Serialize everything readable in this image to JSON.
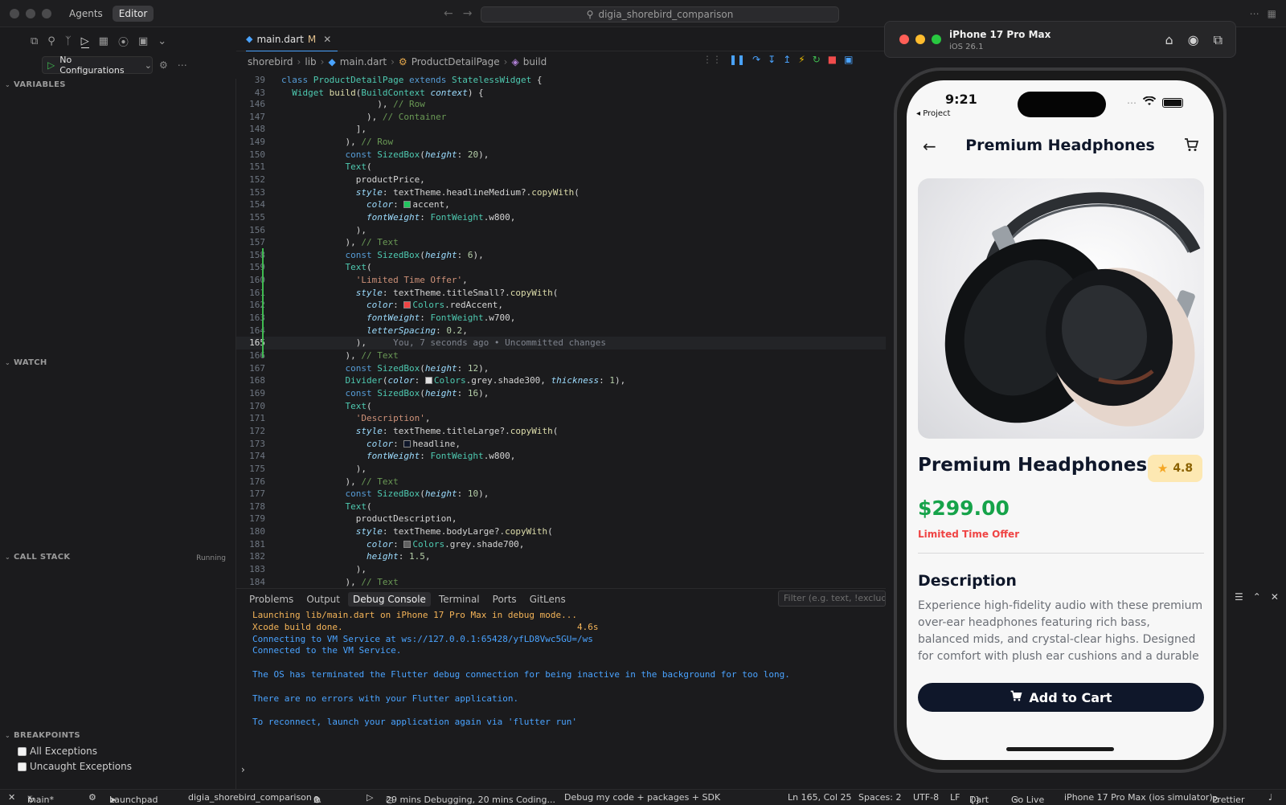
{
  "titlebar": {
    "tabs": [
      "Agents",
      "Editor"
    ],
    "search": "digia_shorebird_comparison"
  },
  "run": {
    "config_label": "No Configurations"
  },
  "sidebar": {
    "variables": "VARIABLES",
    "watch": "WATCH",
    "call_stack": "CALL STACK",
    "call_stack_status": "Running",
    "breakpoints": "BREAKPOINTS",
    "bp_items": [
      "All Exceptions",
      "Uncaught Exceptions"
    ]
  },
  "editor": {
    "tab": {
      "name": "main.dart",
      "badge": "M"
    },
    "breadcrumb": [
      "shorebird",
      "lib",
      "main.dart",
      "ProductDetailPage",
      "build"
    ]
  },
  "code": {
    "sticky": [
      {
        "ln": "39",
        "segs": [
          [
            "kw2",
            "class "
          ],
          [
            "cls",
            "ProductDetailPage "
          ],
          [
            "kw2",
            "extends "
          ],
          [
            "cls",
            "StatelessWidget "
          ],
          [
            "",
            "{"
          ]
        ]
      },
      {
        "ln": "43",
        "segs": [
          [
            "",
            "  "
          ],
          [
            "cls",
            "Widget "
          ],
          [
            "fn",
            "build"
          ],
          [
            "",
            "("
          ],
          [
            "cls",
            "BuildContext "
          ],
          [
            "prop",
            "context"
          ],
          [
            "",
            ") {"
          ]
        ]
      }
    ],
    "lines": [
      {
        "ln": "146",
        "segs": [
          [
            "",
            "                  ), "
          ],
          [
            "cm",
            "// Row"
          ]
        ]
      },
      {
        "ln": "147",
        "segs": [
          [
            "",
            "                ), "
          ],
          [
            "cm",
            "// Container"
          ]
        ]
      },
      {
        "ln": "148",
        "segs": [
          [
            "",
            "              ],"
          ]
        ]
      },
      {
        "ln": "149",
        "segs": [
          [
            "",
            "            ), "
          ],
          [
            "cm",
            "// Row"
          ]
        ]
      },
      {
        "ln": "150",
        "segs": [
          [
            "",
            "            "
          ],
          [
            "kw2",
            "const "
          ],
          [
            "cls",
            "SizedBox"
          ],
          [
            "",
            "("
          ],
          [
            "prop",
            "height"
          ],
          [
            "",
            ": "
          ],
          [
            "num",
            "20"
          ],
          [
            "",
            "),"
          ]
        ]
      },
      {
        "ln": "151",
        "segs": [
          [
            "",
            "            "
          ],
          [
            "cls",
            "Text"
          ],
          [
            "",
            "("
          ]
        ]
      },
      {
        "ln": "152",
        "segs": [
          [
            "",
            "              productPrice,"
          ]
        ]
      },
      {
        "ln": "153",
        "segs": [
          [
            "",
            "              "
          ],
          [
            "prop",
            "style"
          ],
          [
            "",
            ": textTheme.headlineMedium?."
          ],
          [
            "fn",
            "copyWith"
          ],
          [
            "",
            "("
          ]
        ]
      },
      {
        "ln": "154",
        "segs": [
          [
            "",
            "                "
          ],
          [
            "prop",
            "color"
          ],
          [
            "",
            ": "
          ],
          [
            "sw-green",
            ""
          ],
          [
            "",
            "accent,"
          ]
        ]
      },
      {
        "ln": "155",
        "segs": [
          [
            "",
            "                "
          ],
          [
            "prop",
            "fontWeight"
          ],
          [
            "",
            ": "
          ],
          [
            "cls",
            "FontWeight"
          ],
          [
            "",
            ".w800,"
          ]
        ]
      },
      {
        "ln": "156",
        "segs": [
          [
            "",
            "              ),"
          ]
        ]
      },
      {
        "ln": "157",
        "segs": [
          [
            "",
            "            ), "
          ],
          [
            "cm",
            "// Text"
          ]
        ]
      },
      {
        "ln": "158",
        "segs": [
          [
            "",
            "            "
          ],
          [
            "kw2",
            "const "
          ],
          [
            "cls",
            "SizedBox"
          ],
          [
            "",
            "("
          ],
          [
            "prop",
            "height"
          ],
          [
            "",
            ": "
          ],
          [
            "num",
            "6"
          ],
          [
            "",
            "),"
          ]
        ]
      },
      {
        "ln": "159",
        "segs": [
          [
            "",
            "            "
          ],
          [
            "cls",
            "Text"
          ],
          [
            "",
            "("
          ]
        ]
      },
      {
        "ln": "160",
        "segs": [
          [
            "",
            "              "
          ],
          [
            "str",
            "'Limited Time Offer'"
          ],
          [
            "",
            ","
          ]
        ]
      },
      {
        "ln": "161",
        "segs": [
          [
            "",
            "              "
          ],
          [
            "prop",
            "style"
          ],
          [
            "",
            ": textTheme.titleSmall?."
          ],
          [
            "fn",
            "copyWith"
          ],
          [
            "",
            "("
          ]
        ]
      },
      {
        "ln": "162",
        "segs": [
          [
            "",
            "                "
          ],
          [
            "prop",
            "color"
          ],
          [
            "",
            ": "
          ],
          [
            "sw-red",
            ""
          ],
          [
            "cls",
            "Colors"
          ],
          [
            "",
            ".redAccent,"
          ]
        ]
      },
      {
        "ln": "163",
        "segs": [
          [
            "",
            "                "
          ],
          [
            "prop",
            "fontWeight"
          ],
          [
            "",
            ": "
          ],
          [
            "cls",
            "FontWeight"
          ],
          [
            "",
            ".w700,"
          ]
        ]
      },
      {
        "ln": "164",
        "segs": [
          [
            "",
            "                "
          ],
          [
            "prop",
            "letterSpacing"
          ],
          [
            "",
            ": "
          ],
          [
            "num",
            "0.2"
          ],
          [
            "",
            ","
          ]
        ]
      },
      {
        "ln": "165",
        "cur": true,
        "segs": [
          [
            "",
            "              ),     "
          ],
          [
            "blame",
            "You, 7 seconds ago • Uncommitted changes"
          ]
        ]
      },
      {
        "ln": "166",
        "segs": [
          [
            "",
            "            ), "
          ],
          [
            "cm",
            "// Text"
          ]
        ]
      },
      {
        "ln": "167",
        "segs": [
          [
            "",
            "            "
          ],
          [
            "kw2",
            "const "
          ],
          [
            "cls",
            "SizedBox"
          ],
          [
            "",
            "("
          ],
          [
            "prop",
            "height"
          ],
          [
            "",
            ": "
          ],
          [
            "num",
            "12"
          ],
          [
            "",
            "),"
          ]
        ]
      },
      {
        "ln": "168",
        "segs": [
          [
            "",
            "            "
          ],
          [
            "cls",
            "Divider"
          ],
          [
            "",
            "("
          ],
          [
            "prop",
            "color"
          ],
          [
            "",
            ": "
          ],
          [
            "sw-white",
            ""
          ],
          [
            "cls",
            "Colors"
          ],
          [
            "",
            ".grey.shade300, "
          ],
          [
            "prop",
            "thickness"
          ],
          [
            "",
            ": "
          ],
          [
            "num",
            "1"
          ],
          [
            "",
            "),"
          ]
        ]
      },
      {
        "ln": "169",
        "segs": [
          [
            "",
            "            "
          ],
          [
            "kw2",
            "const "
          ],
          [
            "cls",
            "SizedBox"
          ],
          [
            "",
            "("
          ],
          [
            "prop",
            "height"
          ],
          [
            "",
            ": "
          ],
          [
            "num",
            "16"
          ],
          [
            "",
            "),"
          ]
        ]
      },
      {
        "ln": "170",
        "segs": [
          [
            "",
            "            "
          ],
          [
            "cls",
            "Text"
          ],
          [
            "",
            "("
          ]
        ]
      },
      {
        "ln": "171",
        "segs": [
          [
            "",
            "              "
          ],
          [
            "str",
            "'Description'"
          ],
          [
            "",
            ","
          ]
        ]
      },
      {
        "ln": "172",
        "segs": [
          [
            "",
            "              "
          ],
          [
            "prop",
            "style"
          ],
          [
            "",
            ": textTheme.titleLarge?."
          ],
          [
            "fn",
            "copyWith"
          ],
          [
            "",
            "("
          ]
        ]
      },
      {
        "ln": "173",
        "segs": [
          [
            "",
            "                "
          ],
          [
            "prop",
            "color"
          ],
          [
            "",
            ": "
          ],
          [
            "sw-dark",
            ""
          ],
          [
            "",
            "headline,"
          ]
        ]
      },
      {
        "ln": "174",
        "segs": [
          [
            "",
            "                "
          ],
          [
            "prop",
            "fontWeight"
          ],
          [
            "",
            ": "
          ],
          [
            "cls",
            "FontWeight"
          ],
          [
            "",
            ".w800,"
          ]
        ]
      },
      {
        "ln": "175",
        "segs": [
          [
            "",
            "              ),"
          ]
        ]
      },
      {
        "ln": "176",
        "segs": [
          [
            "",
            "            ), "
          ],
          [
            "cm",
            "// Text"
          ]
        ]
      },
      {
        "ln": "177",
        "segs": [
          [
            "",
            "            "
          ],
          [
            "kw2",
            "const "
          ],
          [
            "cls",
            "SizedBox"
          ],
          [
            "",
            "("
          ],
          [
            "prop",
            "height"
          ],
          [
            "",
            ": "
          ],
          [
            "num",
            "10"
          ],
          [
            "",
            "),"
          ]
        ]
      },
      {
        "ln": "178",
        "segs": [
          [
            "",
            "            "
          ],
          [
            "cls",
            "Text"
          ],
          [
            "",
            "("
          ]
        ]
      },
      {
        "ln": "179",
        "segs": [
          [
            "",
            "              productDescription,"
          ]
        ]
      },
      {
        "ln": "180",
        "segs": [
          [
            "",
            "              "
          ],
          [
            "prop",
            "style"
          ],
          [
            "",
            ": textTheme.bodyLarge?."
          ],
          [
            "fn",
            "copyWith"
          ],
          [
            "",
            "("
          ]
        ]
      },
      {
        "ln": "181",
        "segs": [
          [
            "",
            "                "
          ],
          [
            "prop",
            "color"
          ],
          [
            "",
            ": "
          ],
          [
            "sw-grey",
            ""
          ],
          [
            "cls",
            "Colors"
          ],
          [
            "",
            ".grey.shade700,"
          ]
        ]
      },
      {
        "ln": "182",
        "segs": [
          [
            "",
            "                "
          ],
          [
            "prop",
            "height"
          ],
          [
            "",
            ": "
          ],
          [
            "num",
            "1.5"
          ],
          [
            "",
            ","
          ]
        ]
      },
      {
        "ln": "183",
        "segs": [
          [
            "",
            "              ),"
          ]
        ]
      },
      {
        "ln": "184",
        "segs": [
          [
            "",
            "            ), "
          ],
          [
            "cm",
            "// Text"
          ]
        ]
      }
    ]
  },
  "panel": {
    "tabs": [
      "Problems",
      "Output",
      "Debug Console",
      "Terminal",
      "Ports",
      "GitLens"
    ],
    "active_tab": "Debug Console",
    "filter_placeholder": "Filter (e.g. text, !exclude)",
    "console": [
      {
        "text": "Launching lib/main.dart on iPhone 17 Pro Max in debug mode...",
        "color": "orange"
      },
      {
        "text": "Xcode build done.                                            4.6s",
        "color": "orange"
      },
      {
        "text": "Connecting to VM Service at ws://127.0.0.1:65428/yfLD8Vwc5GU=/ws",
        "color": "blue"
      },
      {
        "text": "Connected to the VM Service.",
        "color": "blue"
      },
      {
        "text": "",
        "color": "blue"
      },
      {
        "text": "The OS has terminated the Flutter debug connection for being inactive in the background for too long.",
        "color": "blue"
      },
      {
        "text": "",
        "color": "blue"
      },
      {
        "text": "There are no errors with your Flutter application.",
        "color": "blue"
      },
      {
        "text": "",
        "color": "blue"
      },
      {
        "text": "To reconnect, launch your application again via 'flutter run'",
        "color": "blue"
      }
    ]
  },
  "status": {
    "branch": "main*",
    "launchpad": "Launchpad",
    "project": "digia_shorebird_comparison",
    "errors": "0",
    "warnings": "0",
    "time": "29 mins Debugging, 20 mins Coding...",
    "debug_mode": "Debug my code + packages + SDK",
    "position": "Ln 165, Col 25",
    "spaces": "Spaces: 2",
    "encoding": "UTF-8",
    "eol": "LF",
    "language": "Dart",
    "golive": "Go Live",
    "device": "iPhone 17 Pro Max (ios simulator)",
    "prettier": "Prettier"
  },
  "simulator": {
    "title": "iPhone 17 Pro Max",
    "subtitle": "iOS 26.1",
    "colors": {
      "close": "#ff5f57",
      "min": "#febc2e",
      "max": "#28c840"
    }
  },
  "phone": {
    "time": "9:21",
    "back_label": "◂ Project",
    "appbar_title": "Premium Headphones",
    "product_name": "Premium Headphones",
    "rating": "4.8",
    "price": "$299.00",
    "offer": "Limited Time Offer",
    "desc_title": "Description",
    "description": "Experience high-fidelity audio with these premium over-ear headphones featuring rich bass, balanced mids, and crystal-clear highs. Designed for comfort with plush ear cushions and a durable",
    "cart_button": "Add to Cart",
    "colors": {
      "price": "#16a34a",
      "offer": "#ef4444",
      "button": "#0f172a",
      "rating_bg": "#fde8b2"
    }
  }
}
